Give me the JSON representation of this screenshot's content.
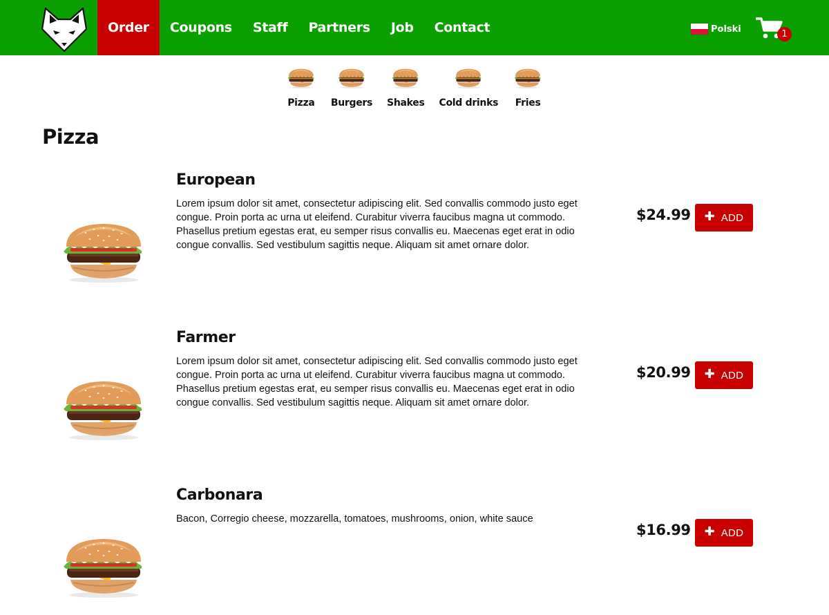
{
  "colors": {
    "header_green": "#0aa100",
    "accent_red": "#c80000"
  },
  "header": {
    "logo_icon": "fox-logo-icon",
    "nav": [
      {
        "label": "Order",
        "active": true
      },
      {
        "label": "Coupons"
      },
      {
        "label": "Staff"
      },
      {
        "label": "Partners"
      },
      {
        "label": "Job"
      },
      {
        "label": "Contact"
      }
    ],
    "language": {
      "flag_icon": "poland-flag-icon",
      "label": "Polski"
    },
    "cart": {
      "icon": "shopping-cart-icon",
      "count": "1"
    }
  },
  "categories": [
    {
      "label": "Pizza",
      "icon": "burger-thumb"
    },
    {
      "label": "Burgers",
      "icon": "burger-thumb"
    },
    {
      "label": "Shakes",
      "icon": "burger-thumb"
    },
    {
      "label": "Cold drinks",
      "icon": "burger-thumb"
    },
    {
      "label": "Fries",
      "icon": "burger-thumb"
    }
  ],
  "section": {
    "title": "Pizza"
  },
  "products": [
    {
      "name": "European",
      "description": "Lorem ipsum dolor sit amet, consectetur adipiscing elit. Sed convallis commodo justo eget congue. Proin porta ac urna ut eleifend. Curabitur viverra faucibus magna ut commodo. Phasellus pretium egestas erat, eu semper risus convallis eu. Maecenas eget erat in odio congue convallis. Sed vestibulum sagittis neque. Aliquam sit amet ornare dolor.",
      "price": "$24.99",
      "add_label": "ADD"
    },
    {
      "name": "Farmer",
      "description": "Lorem ipsum dolor sit amet, consectetur adipiscing elit. Sed convallis commodo justo eget congue. Proin porta ac urna ut eleifend. Curabitur viverra faucibus magna ut commodo. Phasellus pretium egestas erat, eu semper risus convallis eu. Maecenas eget erat in odio congue convallis. Sed vestibulum sagittis neque. Aliquam sit amet ornare dolor.",
      "price": "$20.99",
      "add_label": "ADD"
    },
    {
      "name": "Carbonara",
      "description": "Bacon, Corregio cheese, mozzarella, tomatoes, mushrooms, onion, white sauce",
      "price": "$16.99",
      "add_label": "ADD"
    }
  ]
}
